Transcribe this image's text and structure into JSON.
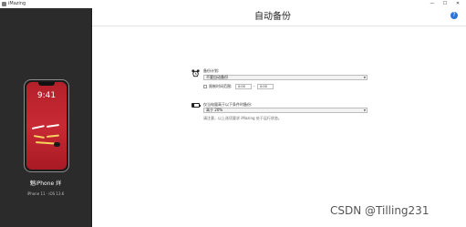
{
  "window": {
    "title": "iMazing",
    "minimize_glyph": "—",
    "maximize_glyph": "☐",
    "close_glyph": "✕"
  },
  "sidebar": {
    "device_name": "魅iPhone 烊",
    "device_info": "iPhone 11 · iOS 13.6",
    "lock_screen": {
      "time": "9:41"
    }
  },
  "main": {
    "title": "自动备份",
    "help_glyph": "?",
    "schedule": {
      "label": "备份计划:",
      "value": "不要自动备份",
      "time_range_label": "限制时间范围:",
      "time_from": "0:00",
      "separator": "-",
      "time_to": "0:00"
    },
    "battery": {
      "label": "仅当电量高于以下条件时备份:",
      "value": "高于 20%",
      "hint": "请注意，以上选项要求 iMazing 处于运行状态。"
    }
  },
  "watermark": "CSDN @Tilling231",
  "colors": {
    "sidebar_bg": "#2b2b2b",
    "wallpaper": "#c82a34",
    "help_accent": "#2a74d8"
  },
  "icons": [
    "app-icon",
    "help-icon",
    "alarm-clock-icon",
    "battery-icon",
    "chevron-down-icon"
  ]
}
